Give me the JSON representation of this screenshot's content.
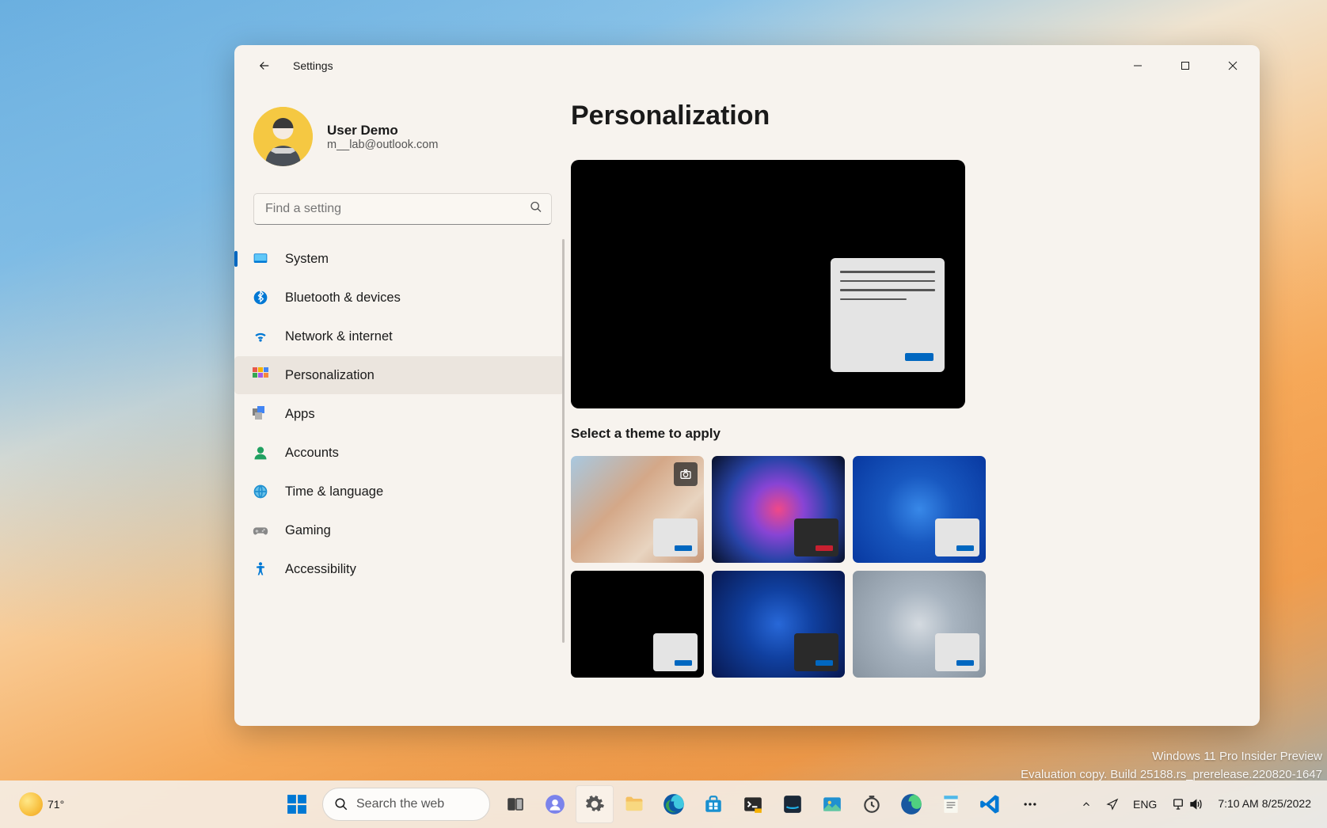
{
  "app": {
    "title": "Settings"
  },
  "user": {
    "name": "User Demo",
    "email": "m__lab@outlook.com"
  },
  "search": {
    "placeholder": "Find a setting"
  },
  "nav": [
    {
      "label": "System"
    },
    {
      "label": "Bluetooth & devices"
    },
    {
      "label": "Network & internet"
    },
    {
      "label": "Personalization"
    },
    {
      "label": "Apps"
    },
    {
      "label": "Accounts"
    },
    {
      "label": "Time & language"
    },
    {
      "label": "Gaming"
    },
    {
      "label": "Accessibility"
    }
  ],
  "page": {
    "title": "Personalization",
    "themes_label": "Select a theme to apply"
  },
  "watermark": {
    "line1": "Windows 11 Pro Insider Preview",
    "line2": "Evaluation copy. Build 25188.rs_prerelease.220820-1647"
  },
  "taskbar": {
    "weather_temp": "71°",
    "search_placeholder": "Search the web",
    "lang": "ENG",
    "time": "7:10 AM",
    "date": "8/25/2022"
  }
}
